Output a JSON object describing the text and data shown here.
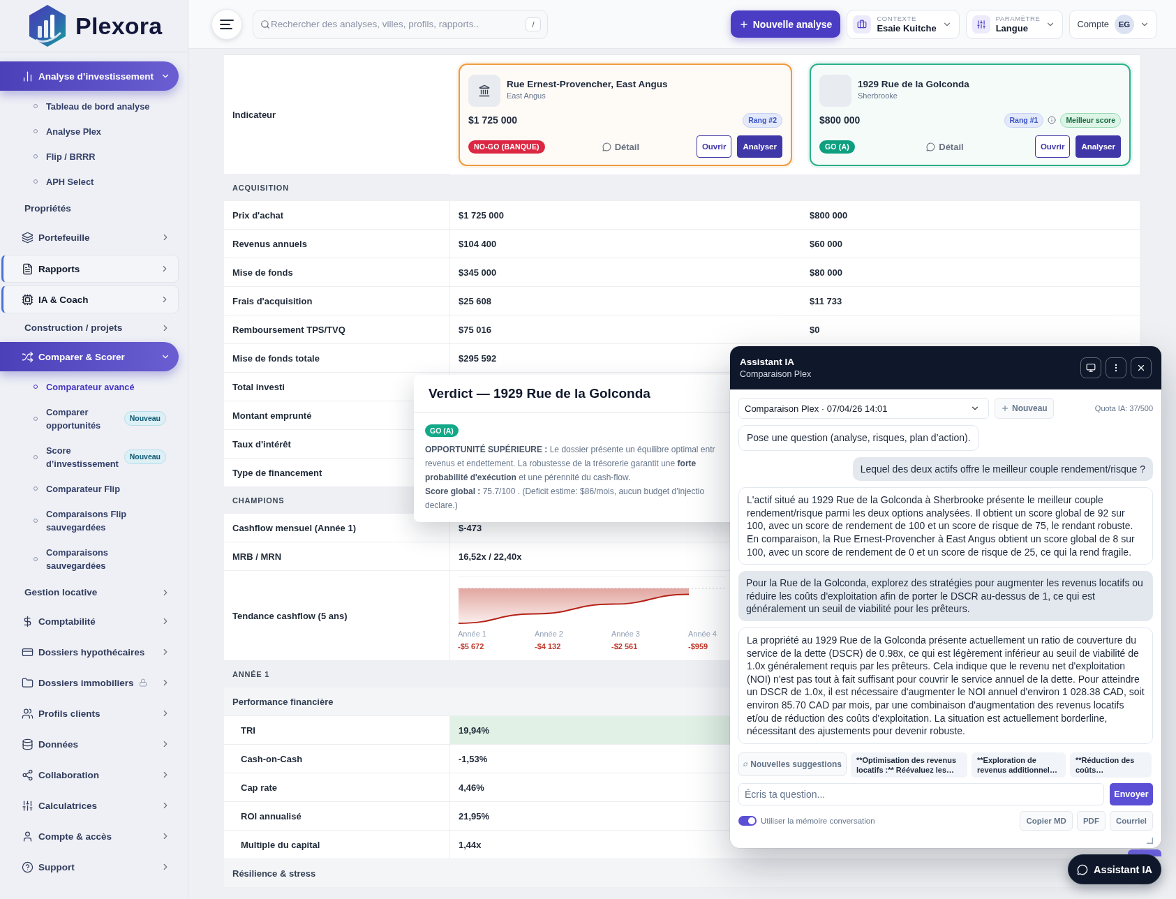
{
  "sidebar": {
    "logo": "Plexora",
    "items": [
      {
        "label": "Analyse d’investissement",
        "expanded": true,
        "highlighted": false,
        "locked": false,
        "children": [
          {
            "label": "Tableau de bord analyse",
            "selected": false
          },
          {
            "label": "Analyse Plex",
            "selected": false
          },
          {
            "label": "Flip / BRRR",
            "selected": false
          },
          {
            "label": "APH Select",
            "selected": false
          }
        ]
      },
      {
        "label": "Propriétés",
        "highlighted": false,
        "locked": false
      },
      {
        "label": "Portefeuille",
        "expanded": false,
        "highlighted": false,
        "locked": false
      },
      {
        "label": "Rapports",
        "expanded": false,
        "highlighted": true,
        "locked": false
      },
      {
        "label": "IA & Coach",
        "expanded": false,
        "highlighted": true,
        "locked": false
      },
      {
        "label": "Construction / projets",
        "expanded": false,
        "highlighted": false,
        "locked": false
      },
      {
        "label": "Comparer & Scorer",
        "expanded": true,
        "highlighted": false,
        "locked": false,
        "children": [
          {
            "label": "Comparateur avancé",
            "selected": true
          },
          {
            "label": "Comparer opportunités",
            "selected": false,
            "badge": "Nouveau"
          },
          {
            "label": "Score d’investissement",
            "selected": false,
            "badge": "Nouveau"
          },
          {
            "label": "Comparateur Flip",
            "selected": false
          },
          {
            "label": "Comparaisons Flip sauvegardées",
            "selected": false
          },
          {
            "label": "Comparaisons sauvegardées",
            "selected": false
          }
        ]
      },
      {
        "label": "Gestion locative",
        "expanded": false,
        "highlighted": false,
        "locked": false
      },
      {
        "label": "Comptabilité",
        "expanded": false,
        "highlighted": false,
        "locked": false
      },
      {
        "label": "Dossiers hypothécaires",
        "expanded": false,
        "highlighted": false,
        "locked": false
      },
      {
        "label": "Dossiers immobiliers",
        "expanded": false,
        "highlighted": false,
        "locked": true
      },
      {
        "label": "Profils clients",
        "expanded": false,
        "highlighted": false,
        "locked": false
      },
      {
        "label": "Données",
        "expanded": false,
        "highlighted": false,
        "locked": false
      },
      {
        "label": "Collaboration",
        "expanded": false,
        "highlighted": false,
        "locked": false
      },
      {
        "label": "Calculatrices",
        "expanded": false,
        "highlighted": false,
        "locked": false
      },
      {
        "label": "Compte & accès",
        "expanded": false,
        "highlighted": false,
        "locked": false
      },
      {
        "label": "Support",
        "expanded": false,
        "highlighted": false,
        "locked": false
      }
    ]
  },
  "header": {
    "search": {
      "placeholder": "Rechercher des analyses, villes, profils, rapports..",
      "shortcut": "/"
    },
    "new_analysis": "Nouvelle analyse",
    "context": {
      "label": "CONTEXTE",
      "value": "Esaie Kuitche"
    },
    "setting": {
      "label": "PARAMÈTRE",
      "value": "Langue"
    },
    "account": {
      "label": "Compte",
      "initials": "EG"
    }
  },
  "comparison": {
    "indicator_label": "Indicateur",
    "cards": [
      {
        "title": "Rue Ernest-Provencher, East Angus",
        "subtitle": "East Angus",
        "thumbnail": {
          "kind": "icon"
        },
        "color": "#ee9b3f",
        "price": "$1 725 000",
        "rank": "Rang #2",
        "status": {
          "label": "NO-GO (BANQUE)",
          "color": "#dc2742"
        },
        "detail": "Détail",
        "buttons": [
          {
            "label": "Ouvrir",
            "kind": "outline"
          },
          {
            "label": "Analyser",
            "kind": "primary"
          }
        ]
      },
      {
        "title": "1929 Rue de la Golconda",
        "subtitle": "Sherbrooke",
        "thumbnail": {
          "kind": "blank"
        },
        "color": "#2bb08a",
        "price": "$800 000",
        "rank": "Rang #1",
        "best_label": "Meilleur score",
        "status": {
          "label": "GO (A)",
          "color": "#0e9f7e"
        },
        "detail": "Détail",
        "buttons": [
          {
            "label": "Ouvrir",
            "kind": "outline"
          },
          {
            "label": "Analyser",
            "kind": "primary"
          }
        ]
      }
    ],
    "rows": [
      {
        "kind": "section",
        "label": "ACQUISITION"
      },
      {
        "kind": "row",
        "label": "Prix d'achat",
        "cells": [
          {
            "text": "$1 725 000",
            "best": false
          },
          {
            "text": "$800 000",
            "best": false
          }
        ]
      },
      {
        "kind": "row",
        "label": "Revenus annuels",
        "cells": [
          {
            "text": "$104 400",
            "best": false
          },
          {
            "text": "$60 000",
            "best": false
          }
        ]
      },
      {
        "kind": "row",
        "label": "Mise de fonds",
        "cells": [
          {
            "text": "$345 000",
            "best": false
          },
          {
            "text": "$80 000",
            "best": false
          }
        ]
      },
      {
        "kind": "row",
        "label": "Frais d'acquisition",
        "cells": [
          {
            "text": "$25 608",
            "best": false
          },
          {
            "text": "$11 733",
            "best": false
          }
        ]
      },
      {
        "kind": "row",
        "label": "Remboursement TPS/TVQ",
        "cells": [
          {
            "text": "$75 016",
            "best": false
          },
          {
            "text": "$0",
            "best": false
          }
        ]
      },
      {
        "kind": "row",
        "label": "Mise de fonds totale",
        "cells": [
          {
            "text": "$295 592",
            "best": false
          }
        ]
      },
      {
        "kind": "row",
        "label": "Total investi"
      },
      {
        "kind": "row",
        "label": "Montant emprunté"
      },
      {
        "kind": "row",
        "label": "Taux d'intérêt"
      },
      {
        "kind": "row",
        "label": "Type de financement"
      },
      {
        "kind": "section",
        "label": "CHAMPIONS"
      },
      {
        "kind": "row",
        "label": "Cashflow mensuel (Année 1)",
        "cells": [
          {
            "text": "$-473",
            "best": false
          }
        ]
      },
      {
        "kind": "row",
        "label": "MRB / MRN",
        "cells": [
          {
            "text": "16,52x / 22,40x",
            "best": false
          }
        ]
      },
      {
        "kind": "chart",
        "label": "Tendance cashflow (5 ans)",
        "chart_data": {
          "type": "area",
          "categories": [
            "Année 1",
            "Année 2",
            "Année 3",
            "Année 4"
          ],
          "values": [
            -5672,
            -4132,
            -2561,
            -959
          ],
          "value_labels": [
            "-$5 672",
            "-$4 132",
            "-$2 561",
            "-$959"
          ]
        }
      },
      {
        "kind": "section",
        "label": "ANNÉE 1"
      },
      {
        "kind": "group",
        "label": "Performance financière"
      },
      {
        "kind": "subrow",
        "label": "TRI",
        "cells": [
          {
            "text": "19,94%",
            "best": true
          }
        ]
      },
      {
        "kind": "subrow",
        "label": "Cash-on-Cash",
        "cells": [
          {
            "text": "-1,53%",
            "best": false
          }
        ]
      },
      {
        "kind": "subrow",
        "label": "Cap rate",
        "cells": [
          {
            "text": "4,46%",
            "best": false
          }
        ]
      },
      {
        "kind": "subrow",
        "label": "ROI annualisé",
        "cells": [
          {
            "text": "21,95%",
            "best": false
          }
        ]
      },
      {
        "kind": "subrow",
        "label": "Multiple du capital",
        "cells": [
          {
            "text": "1,44x",
            "best": false
          }
        ]
      },
      {
        "kind": "group",
        "label": "Résilience & stress"
      }
    ]
  },
  "verdict": {
    "title": "Verdict — 1929 Rue de la Golconda",
    "badge": {
      "label": "GO (A)",
      "color": "#12a888"
    },
    "paragraphs": [
      "**OPPORTUNITÉ SUPÉRIEURE :** Le dossier présente un équilibre optimal entr\nrevenus et endettement. La robustesse de la trésorerie garantit une **forte**\n**probabilité d'exécution** et une pérennité du cash-flow.",
      "**Score global :** 75.7/100 . (Deficit estime: $86/mois, aucun budget d’injectio\ndeclare.)"
    ]
  },
  "assistant": {
    "title": "Assistant IA",
    "subtitle": "Comparaison Plex",
    "conversation": "Comparaison Plex · 07/04/26 14:01",
    "new_button": "Nouveau",
    "quota": "Quota IA: 37/500",
    "messages": [
      {
        "kind": "assistant",
        "text": "Pose une question (analyse, risques, plan d’action)."
      },
      {
        "kind": "user",
        "text": "Lequel des deux actifs offre le meilleur couple rendement/risque ?"
      },
      {
        "kind": "assistant",
        "text": "L'actif situé au 1929 Rue de la Golconda à Sherbrooke présente le meilleur couple rendement/risque parmi les deux options analysées. Il obtient un score global de 92 sur 100, avec un score de rendement de 100 et un score de risque de 75, le rendant robuste. En comparaison, la Rue Ernest-Provencher à East Angus obtient un score global de 8 sur 100, avec un score de rendement de 0 et un score de risque de 25, ce qui la rend fragile."
      },
      {
        "kind": "user",
        "text": "Pour la Rue de la Golconda, explorez des stratégies pour augmenter les revenus locatifs ou réduire les coûts d'exploitation afin de porter le DSCR au-dessus de 1, ce qui est généralement un seuil de viabilité pour les prêteurs."
      },
      {
        "kind": "assistant",
        "text": "La propriété au 1929 Rue de la Golconda présente actuellement un ratio de couverture du service de la dette (DSCR) de 0.98x, ce qui est légèrement inférieur au seuil de viabilité de 1.0x généralement requis par les prêteurs. Cela indique que le revenu net d'exploitation (NOI) n'est pas tout à fait suffisant pour couvrir le service annuel de la dette. Pour atteindre un DSCR de 1.0x, il est nécessaire d'augmenter le NOI annuel d'environ 1 028.38 CAD, soit environ 85.70 CAD par mois, par une combinaison d'augmentation des revenus locatifs et/ou de réduction des coûts d'exploitation. La situation est actuellement borderline, nécessitant des ajustements pour devenir robuste."
      }
    ],
    "suggestions_button": "Nouvelles suggestions",
    "suggestions": [
      "**Optimisation des revenus locatifs :** Réévaluez les…",
      "**Exploration de revenus additionnel…",
      "**Réduction des coûts…"
    ],
    "input": {
      "placeholder": "Écris ta question..."
    },
    "send": "Envoyer",
    "memory": {
      "label": "Utiliser la mémoire conversation",
      "on": true
    },
    "actions": [
      "Copier MD",
      "PDF",
      "Courriel"
    ]
  },
  "fab": {
    "label": "Assistant IA"
  }
}
